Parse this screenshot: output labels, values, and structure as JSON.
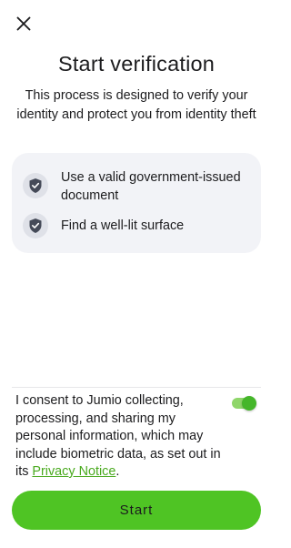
{
  "header": {
    "close_icon": "close-icon"
  },
  "title": "Start verification",
  "subtitle": "This process is designed to verify your identity and protect you from identity theft",
  "tips": [
    {
      "icon": "shield-check-icon",
      "label": "Use a valid government-issued document"
    },
    {
      "icon": "shield-check-icon",
      "label": "Find a well-lit surface"
    }
  ],
  "consent": {
    "text": "I consent to Jumio collecting, processing, and sharing my personal information, which may include biometric data, as set out in its ",
    "link_label": "Privacy Notice",
    "suffix": ".",
    "toggle_on": true
  },
  "start_button": {
    "label": "Start"
  },
  "colors": {
    "accent": "#4fc424",
    "link": "#4aaa1f",
    "card_bg": "#f2f3f7"
  }
}
